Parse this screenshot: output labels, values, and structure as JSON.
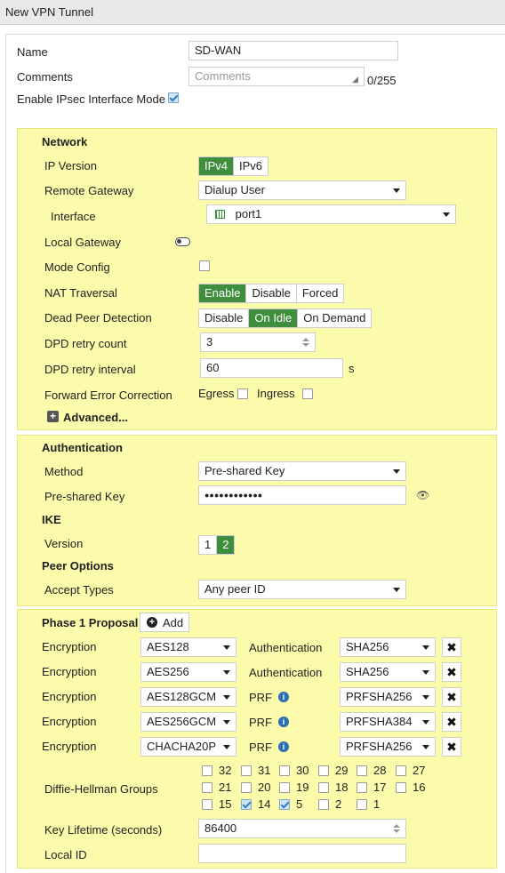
{
  "window_title": "New VPN Tunnel",
  "top": {
    "name_label": "Name",
    "name_value": "SD-WAN",
    "comments_label": "Comments",
    "comments_placeholder": "Comments",
    "comments_counter": "0/255",
    "ipsec_mode_label": "Enable IPsec Interface Mode",
    "ipsec_mode_checked": true
  },
  "network": {
    "header": "Network",
    "ip_version_label": "IP Version",
    "ip_version_options": [
      "IPv4",
      "IPv6"
    ],
    "ip_version_selected": "IPv4",
    "remote_gateway_label": "Remote Gateway",
    "remote_gateway_value": "Dialup User",
    "interface_label": "Interface",
    "interface_value": "port1",
    "local_gateway_label": "Local Gateway",
    "local_gateway_on": false,
    "mode_config_label": "Mode Config",
    "mode_config_checked": false,
    "nat_label": "NAT Traversal",
    "nat_options": [
      "Enable",
      "Disable",
      "Forced"
    ],
    "nat_selected": "Enable",
    "dpd_label": "Dead Peer Detection",
    "dpd_options": [
      "Disable",
      "On Idle",
      "On Demand"
    ],
    "dpd_selected": "On Idle",
    "dpd_retry_count_label": "DPD retry count",
    "dpd_retry_count_value": "3",
    "dpd_retry_interval_label": "DPD retry interval",
    "dpd_retry_interval_value": "60",
    "dpd_retry_interval_unit": "s",
    "fec_label": "Forward Error Correction",
    "fec_egress_label": "Egress",
    "fec_ingress_label": "Ingress",
    "advanced_label": "Advanced..."
  },
  "authentication": {
    "header": "Authentication",
    "method_label": "Method",
    "method_value": "Pre-shared Key",
    "psk_label": "Pre-shared Key",
    "psk_value": "●●●●●●●●●●●●",
    "ike_header": "IKE",
    "version_label": "Version",
    "version_options": [
      "1",
      "2"
    ],
    "version_selected": "2",
    "peer_options_header": "Peer Options",
    "accept_types_label": "Accept Types",
    "accept_types_value": "Any peer ID"
  },
  "phase1": {
    "header": "Phase 1 Proposal",
    "add_label": "Add",
    "rows": [
      {
        "enc_label": "Encryption",
        "enc_value": "AES128",
        "auth_label": "Authentication",
        "auth_value": "SHA256",
        "info": false
      },
      {
        "enc_label": "Encryption",
        "enc_value": "AES256",
        "auth_label": "Authentication",
        "auth_value": "SHA256",
        "info": false
      },
      {
        "enc_label": "Encryption",
        "enc_value": "AES128GCM",
        "auth_label": "PRF",
        "auth_value": "PRFSHA256",
        "info": true
      },
      {
        "enc_label": "Encryption",
        "enc_value": "AES256GCM",
        "auth_label": "PRF",
        "auth_value": "PRFSHA384",
        "info": true
      },
      {
        "enc_label": "Encryption",
        "enc_value": "CHACHA20P",
        "auth_label": "PRF",
        "auth_value": "PRFSHA256",
        "info": true
      }
    ],
    "dh_label": "Diffie-Hellman Groups",
    "dh_groups": [
      {
        "num": "32",
        "checked": false
      },
      {
        "num": "31",
        "checked": false
      },
      {
        "num": "30",
        "checked": false
      },
      {
        "num": "29",
        "checked": false
      },
      {
        "num": "28",
        "checked": false
      },
      {
        "num": "27",
        "checked": false
      },
      {
        "num": "21",
        "checked": false
      },
      {
        "num": "20",
        "checked": false
      },
      {
        "num": "19",
        "checked": false
      },
      {
        "num": "18",
        "checked": false
      },
      {
        "num": "17",
        "checked": false
      },
      {
        "num": "16",
        "checked": false
      },
      {
        "num": "15",
        "checked": false
      },
      {
        "num": "14",
        "checked": true
      },
      {
        "num": "5",
        "checked": true
      },
      {
        "num": "2",
        "checked": false
      },
      {
        "num": "1",
        "checked": false
      }
    ],
    "key_lifetime_label": "Key Lifetime (seconds)",
    "key_lifetime_value": "86400",
    "local_id_label": "Local ID",
    "local_id_value": ""
  },
  "colors": {
    "section_bg": "#fbfbab",
    "selected_green": "#3e8e3e",
    "info_blue": "#2e6fb0"
  }
}
